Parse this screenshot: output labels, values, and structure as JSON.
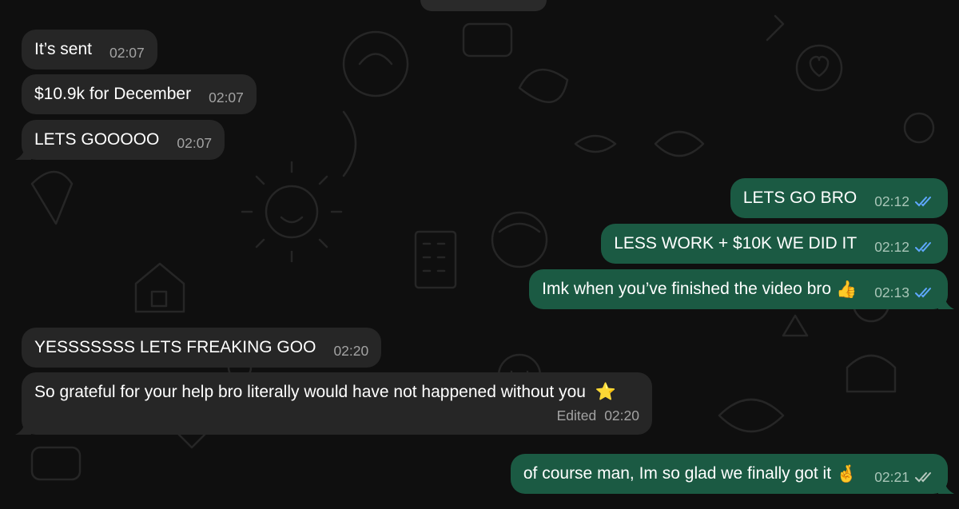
{
  "theme": {
    "incoming_bubble": "#262626",
    "outgoing_bubble": "#1b5a43",
    "read_tick_color": "#5fa8ff",
    "delivered_tick_color": "#b9c9c0",
    "background": "#0f0f0f"
  },
  "messages": [
    {
      "direction": "in",
      "text": "It’s sent",
      "time": "02:07"
    },
    {
      "direction": "in",
      "text": "$10.9k for December",
      "time": "02:07"
    },
    {
      "direction": "in",
      "text": "LETS GOOOOO",
      "time": "02:07"
    },
    {
      "direction": "out",
      "text": "LETS GO BRO",
      "time": "02:12",
      "status": "read"
    },
    {
      "direction": "out",
      "text": "LESS WORK + $10K WE DID IT",
      "time": "02:12",
      "status": "read"
    },
    {
      "direction": "out",
      "text": "Imk when you’ve finished the video bro",
      "emoji": "👍",
      "time": "02:13",
      "status": "read"
    },
    {
      "direction": "in",
      "text": "YESSSSSSS LETS FREAKING GOO",
      "time": "02:20"
    },
    {
      "direction": "in",
      "text": "So grateful for your help bro literally would have not happened without you",
      "emoji": "⭐",
      "edited_label": "Edited",
      "time": "02:20"
    },
    {
      "direction": "out",
      "text": "of course man, Im so glad we finally got it",
      "emoji": "🤞",
      "time": "02:21",
      "status": "delivered"
    }
  ]
}
